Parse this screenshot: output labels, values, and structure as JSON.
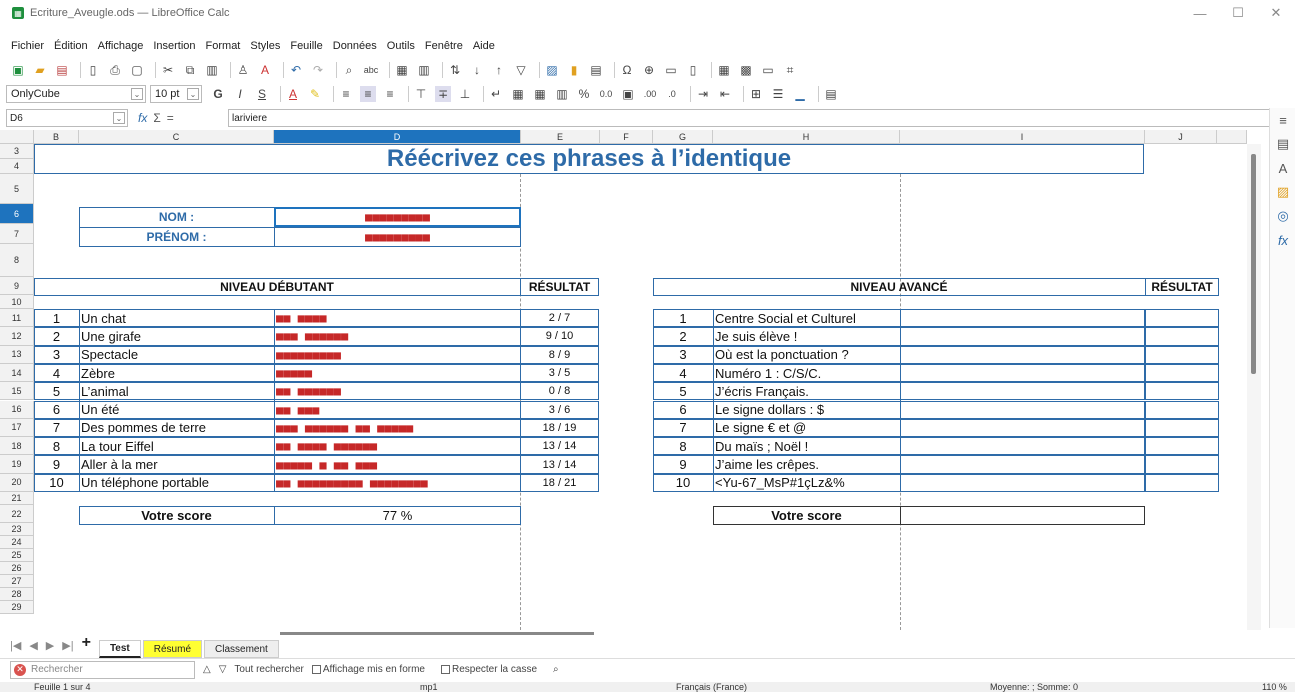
{
  "window": {
    "title": "Ecriture_Aveugle.ods — LibreOffice Calc",
    "min": "—",
    "max": "☐",
    "close": "✕"
  },
  "menu": [
    "Fichier",
    "Édition",
    "Affichage",
    "Insertion",
    "Format",
    "Styles",
    "Feuille",
    "Données",
    "Outils",
    "Fenêtre",
    "Aide"
  ],
  "formatting": {
    "font_name": "OnlyCube",
    "font_size": "10 pt"
  },
  "formula_bar": {
    "cell_ref": "D6",
    "content": "lariviere"
  },
  "columns": [
    "B",
    "C",
    "D",
    "E",
    "F",
    "G",
    "H",
    "I",
    "J"
  ],
  "rows": [
    "3",
    "4",
    "5",
    "6",
    "7",
    "8",
    "9",
    "10",
    "11",
    "12",
    "13",
    "14",
    "15",
    "16",
    "17",
    "18",
    "19",
    "20",
    "21",
    "22",
    "23",
    "24",
    "25",
    "26",
    "27",
    "28",
    "29"
  ],
  "sheet": {
    "title": "Réécrivez ces phrases à l’identique",
    "nom_label": "NOM :",
    "prenom_label": "PRÉNOM :",
    "nom_value": "■■■■■■■■■",
    "prenom_value": "■■■■■■■■■",
    "beginner_header": "NIVEAU DÉBUTANT",
    "advanced_header": "NIVEAU AVANCÉ",
    "result_header": "RÉSULTAT",
    "score_label": "Votre score",
    "score_value": "77 %",
    "beginner_items": [
      {
        "n": "1",
        "text": "Un chat",
        "typed": "■■ ■■■■",
        "result": "2 / 7"
      },
      {
        "n": "2",
        "text": "Une girafe",
        "typed": "■■■ ■■■■■■",
        "result": "9 / 10"
      },
      {
        "n": "3",
        "text": "Spectacle",
        "typed": "■■■■■■■■■",
        "result": "8 / 9"
      },
      {
        "n": "4",
        "text": "Zèbre",
        "typed": "■■■■■",
        "result": "3 / 5"
      },
      {
        "n": "5",
        "text": "L’animal",
        "typed": "■■ ■■■■■■",
        "result": "0 / 8"
      },
      {
        "n": "6",
        "text": "Un été",
        "typed": "■■ ■■■",
        "result": "3 / 6"
      },
      {
        "n": "7",
        "text": "Des pommes de terre",
        "typed": "■■■ ■■■■■■ ■■ ■■■■■",
        "result": "18 / 19"
      },
      {
        "n": "8",
        "text": "La tour Eiffel",
        "typed": "■■ ■■■■ ■■■■■■",
        "result": "13 / 14"
      },
      {
        "n": "9",
        "text": "Aller à la mer",
        "typed": "■■■■■ ■ ■■ ■■■",
        "result": "13 / 14"
      },
      {
        "n": "10",
        "text": "Un téléphone portable",
        "typed": "■■ ■■■■■■■■■ ■■■■■■■■",
        "result": "18 / 21"
      }
    ],
    "advanced_items": [
      {
        "n": "1",
        "text": "Centre Social et Culturel"
      },
      {
        "n": "2",
        "text": "Je suis élève !"
      },
      {
        "n": "3",
        "text": "Où est la ponctuation ?"
      },
      {
        "n": "4",
        "text": "Numéro 1 : C/S/C."
      },
      {
        "n": "5",
        "text": "J’écris Français."
      },
      {
        "n": "6",
        "text": "Le signe dollars : $"
      },
      {
        "n": "7",
        "text": "Le signe € et @"
      },
      {
        "n": "8",
        "text": "Du maïs ; Noël !"
      },
      {
        "n": "9",
        "text": "J’aime les crêpes."
      },
      {
        "n": "10",
        "text": "<Yu-67_MsP#1çLz&%"
      }
    ]
  },
  "tabs": [
    "Test",
    "Résumé",
    "Classement"
  ],
  "find": {
    "placeholder": "Rechercher",
    "find_all": "Tout rechercher",
    "formatted": "Affichage mis en forme",
    "match_case": "Respecter la casse"
  },
  "status": {
    "sheet": "Feuille 1 sur 4",
    "style": "mp1",
    "lang": "Français (France)",
    "sum": "Moyenne: ; Somme: 0",
    "zoom": "110 %"
  },
  "colors": {
    "accent": "#2e6ba8",
    "masked": "#c62828",
    "selection": "#1e73be"
  }
}
